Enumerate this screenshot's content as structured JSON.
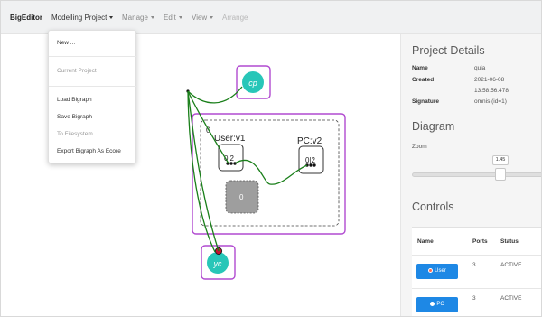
{
  "navbar": {
    "brand": "BigEditor",
    "menus": [
      {
        "label": "Modelling Project"
      },
      {
        "label": "Manage"
      },
      {
        "label": "Edit"
      },
      {
        "label": "View"
      },
      {
        "label": "Arrange"
      }
    ]
  },
  "dropdown": {
    "items": [
      {
        "label": "New ..."
      },
      {
        "label": "Current Project"
      },
      {
        "label": "Load Bigraph"
      },
      {
        "label": "Save Bigraph"
      },
      {
        "label": "To Filesystem"
      },
      {
        "label": "Export Bigraph As Ecore"
      }
    ]
  },
  "diagram": {
    "outer_root_label": "0",
    "outer_node_user_label": "User:v1",
    "outer_node_pc_label": "PC:v2",
    "user_inner_label": "0|2",
    "pc_inner_label": "0|2",
    "site_label": "0",
    "outer_name_cp": "cp",
    "outer_name_yc": "yc",
    "colors": {
      "link": "#1a7f1a",
      "region": "#b14ad0",
      "name_fill": "#28c6b8",
      "site_fill": "#9e9e9e"
    }
  },
  "project_details": {
    "title": "Project Details",
    "name_key": "Name",
    "name_value": "quia",
    "created_key": "Created",
    "created_date": "2021-06-08",
    "created_time": "13:58:56.478",
    "signature_key": "Signature",
    "signature_value": "omnis (id=1)"
  },
  "diagram_panel": {
    "title": "Diagram",
    "zoom_label": "Zoom",
    "zoom_value": "1.45"
  },
  "controls": {
    "title": "Controls",
    "headers": {
      "name": "Name",
      "ports": "Ports",
      "status": "Status"
    },
    "rows": [
      {
        "name": "User",
        "ports": "3",
        "status": "ACTIVE",
        "dot_color": "#ff6a4d"
      },
      {
        "name": "PC",
        "ports": "3",
        "status": "ACTIVE",
        "dot_color": "#ffffff"
      }
    ]
  }
}
